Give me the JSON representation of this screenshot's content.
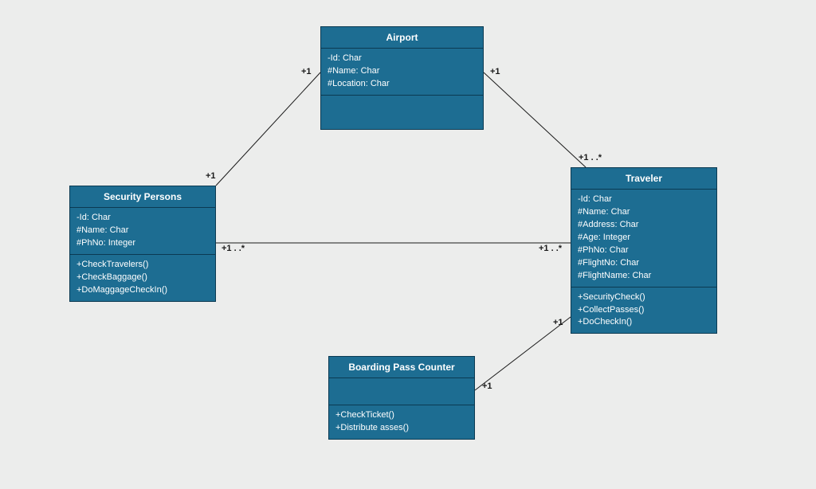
{
  "classes": {
    "airport": {
      "name": "Airport",
      "attributes": [
        "-Id: Char",
        "#Name: Char",
        "#Location: Char"
      ],
      "operations": []
    },
    "security": {
      "name": "Security Persons",
      "attributes": [
        "-Id: Char",
        "#Name: Char",
        "#PhNo: Integer"
      ],
      "operations": [
        "+CheckTravelers()",
        "+CheckBaggage()",
        "+DoMaggageCheckIn()"
      ]
    },
    "traveler": {
      "name": "Traveler",
      "attributes": [
        "-Id: Char",
        "#Name: Char",
        "#Address: Char",
        "#Age: Integer",
        "#PhNo: Char",
        "#FlightNo: Char",
        "#FlightName: Char"
      ],
      "operations": [
        "+SecurityCheck()",
        "+CollectPasses()",
        "+DoCheckIn()"
      ]
    },
    "boarding": {
      "name": "Boarding Pass Counter",
      "attributes": [],
      "operations": [
        "+CheckTicket()",
        "+Distribute asses()"
      ]
    }
  },
  "labels": {
    "airport_left": "+1",
    "airport_right": "+1",
    "security_top": "+1",
    "security_right": "+1 . .*",
    "traveler_top": "+1 . .*",
    "traveler_left_mid": "+1 . .*",
    "traveler_bottom": "+1",
    "boarding_right": "+1"
  }
}
